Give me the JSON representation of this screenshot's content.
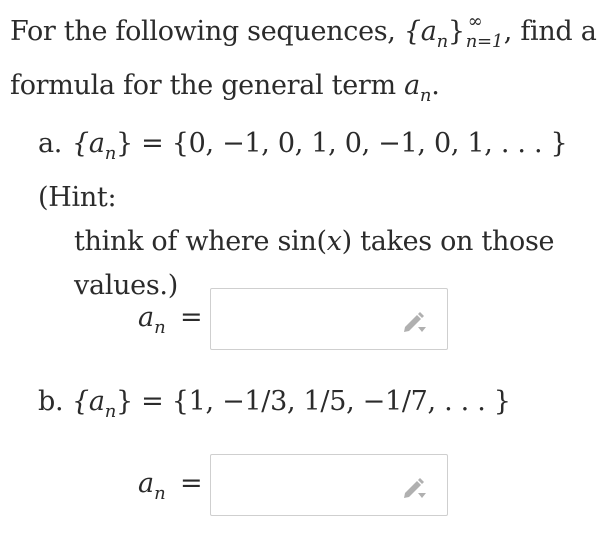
{
  "intro": {
    "text_before": "For the following sequences, ",
    "set_expr": "{a",
    "set_sub": "n",
    "set_close": "}",
    "sup": "∞",
    "sub_range": "n=1",
    "text_after": ", find a formula for the general term ",
    "term": "a",
    "term_sub": "n",
    "period": "."
  },
  "part_a": {
    "label": "a.",
    "lhs": "{a",
    "lhs_sub": "n",
    "lhs_close": "}",
    "eq": " = ",
    "sequence": "{0, −1, 0, 1, 0, −1, 0, 1, . . . }",
    "hint_line1": " (Hint:",
    "hint_line2": "think of where sin(",
    "hint_var": "x",
    "hint_line2b": ") takes on those",
    "hint_line3": "values.)"
  },
  "part_b": {
    "label": "b.",
    "lhs": "{a",
    "lhs_sub": "n",
    "lhs_close": "}",
    "eq": " = ",
    "sequence": "{1, −1/3, 1/5, −1/7, . . . }"
  },
  "answers": [
    {
      "var": "a",
      "sub": "n",
      "eq": "="
    },
    {
      "var": "a",
      "sub": "n",
      "eq": "="
    }
  ],
  "colors": {
    "text": "#2b2b2b",
    "box_border": "#cfcfcf",
    "pencil": "#b0b0b0"
  },
  "icons": {
    "edit": "pencil-icon"
  }
}
